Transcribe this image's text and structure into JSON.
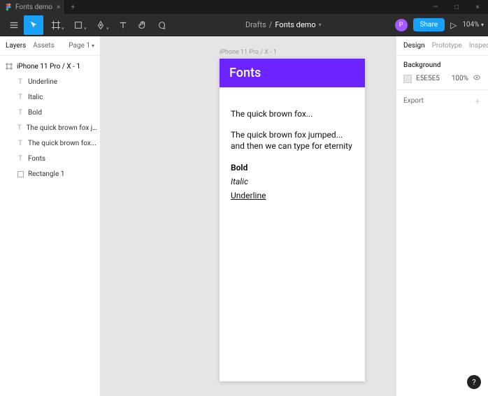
{
  "titlebar": {
    "tab_title": "Fonts demo",
    "close": "×",
    "add": "+"
  },
  "win": {
    "min": "—",
    "max": "□",
    "close": "×"
  },
  "toolbar": {
    "center_breadcrumb": "Drafts",
    "center_sep": "/",
    "center_doc": "Fonts demo",
    "avatar_initial": "P",
    "share": "Share",
    "zoom": "104%"
  },
  "left": {
    "tab_layers": "Layers",
    "tab_assets": "Assets",
    "page": "Page 1",
    "frame": "iPhone 11 Pro / X - 1",
    "frame_chev": "#",
    "layers": [
      "Underline",
      "Italic",
      "Bold",
      "The quick brown fox jumped......",
      "The quick brown fox...",
      "Fonts",
      "Rectangle 1"
    ]
  },
  "canvas": {
    "frame_label": "iPhone 11 Pro / X - 1",
    "header": "Fonts",
    "line1": "The quick brown fox...",
    "line2": "The quick brown fox jumped... and then we can type for eternity",
    "bold": "Bold",
    "italic": "Italic",
    "underline": "Underline"
  },
  "right": {
    "tab_design": "Design",
    "tab_prototype": "Prototype",
    "tab_inspect": "Inspect",
    "bg_label": "Background",
    "bg_hex": "E5E5E5",
    "bg_pct": "100%",
    "export": "Export"
  },
  "help": "?"
}
